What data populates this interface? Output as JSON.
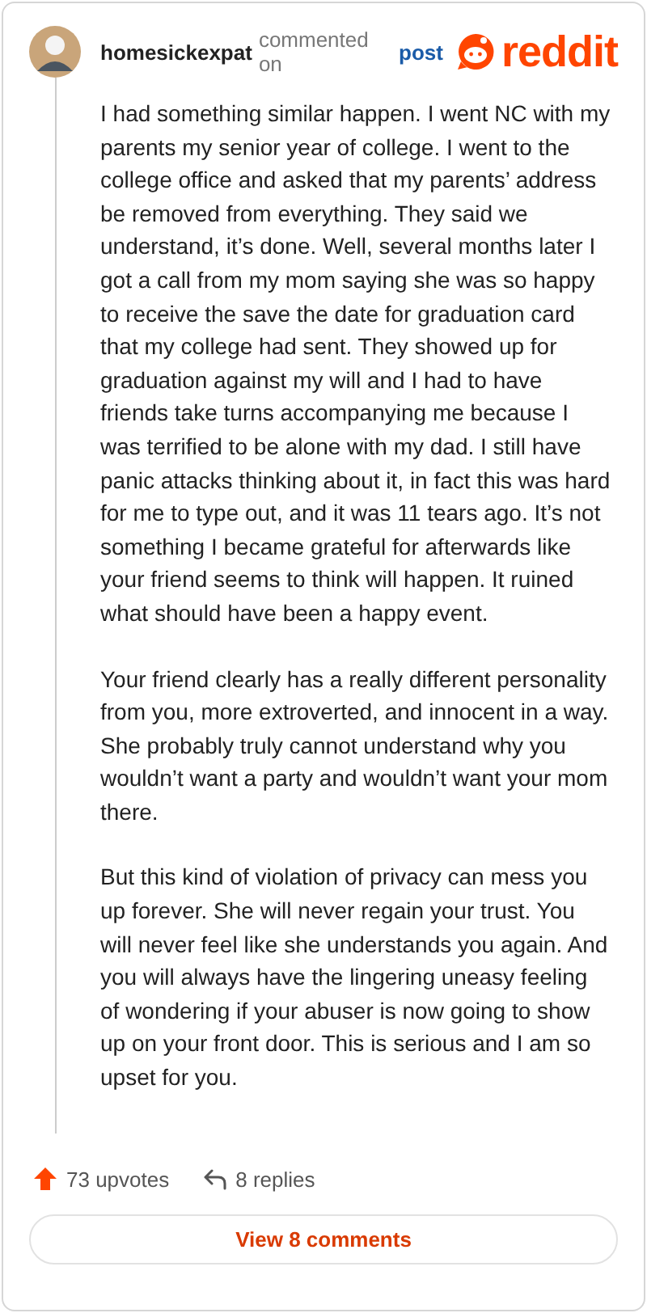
{
  "header": {
    "username": "homesickexpat",
    "action": "commented on",
    "link": "post",
    "logo_text": "reddit"
  },
  "paragraphs": [
    "I had something similar happen. I went NC with my parents my senior year of college. I went to the college office and asked that my parents’ address be removed from everything. They said we understand, it’s done. Well, several months later I got a call from my mom saying she was so happy to receive the save the date for graduation card that my college had sent. They showed up for graduation against my will and I had to have friends take turns accompanying me because I was terrified to be alone with my dad. I still have panic attacks thinking about it, in fact this was hard for me to type out, and it was 11 tears ago. It’s not something I became grateful for afterwards like your friend seems to think will happen. It ruined what should have been a happy event.",
    "Your friend clearly has a really different personality from you, more extroverted, and innocent in a way. She probably truly cannot understand why you wouldn’t want a party and wouldn’t want your mom there.",
    "But this kind of violation of privacy can mess you up forever. She will never regain your trust. You will never feel like she understands you again. And you will always have the lingering uneasy feeling of wondering if your abuser is now going to show up on your front door. This is serious and I am so upset for you."
  ],
  "footer": {
    "upvotes": "73 upvotes",
    "replies": "8 replies",
    "view_button": "View 8 comments"
  }
}
